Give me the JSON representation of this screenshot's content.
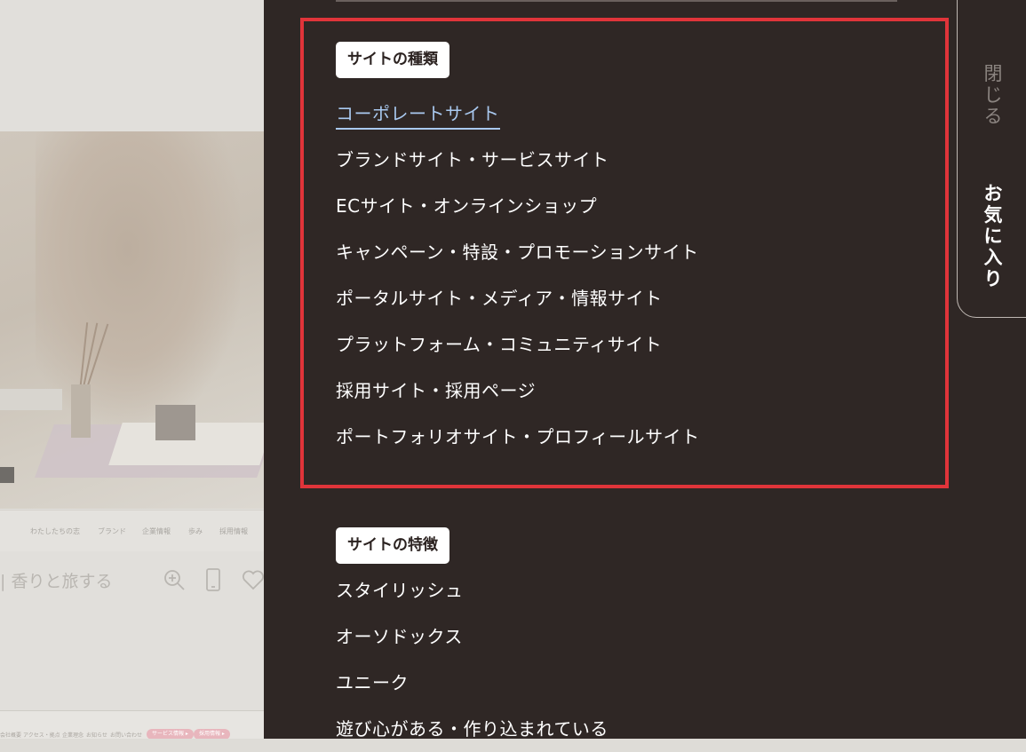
{
  "left_page": {
    "nav_items": [
      "わたしたちの志",
      "ブランド",
      "企業情報",
      "歩み",
      "採用情報"
    ],
    "caption": "| 香りと旅する",
    "bottom_items": [
      "会社概要",
      "アクセス・拠点",
      "企業理念",
      "お知らせ",
      "お問い合わせ"
    ],
    "bottom_pills": [
      "サービス情報 ▸",
      "採用情報 ▸"
    ],
    "icons": [
      "zoom-in-icon",
      "mobile-icon",
      "heart-icon"
    ]
  },
  "panel": {
    "site_types": {
      "label": "サイトの種類",
      "items": [
        "コーポレートサイト",
        "ブランドサイト・サービスサイト",
        "ECサイト・オンラインショップ",
        "キャンペーン・特設・プロモーションサイト",
        "ポータルサイト・メディア・情報サイト",
        "プラットフォーム・コミュニティサイト",
        "採用サイト・採用ページ",
        "ポートフォリオサイト・プロフィールサイト"
      ],
      "active_index": 0
    },
    "site_features": {
      "label": "サイトの特徴",
      "items": [
        "スタイリッシュ",
        "オーソドックス",
        "ユニーク",
        "遊び心がある・作り込まれている"
      ]
    },
    "colors": {
      "background": "#2f2725",
      "highlight": "#e0343a",
      "active": "#a9c9f0"
    }
  },
  "side_tab": {
    "close_label": [
      "閉",
      "じ",
      "る"
    ],
    "favorites_label": [
      "お",
      "気",
      "に",
      "入",
      "り"
    ]
  }
}
